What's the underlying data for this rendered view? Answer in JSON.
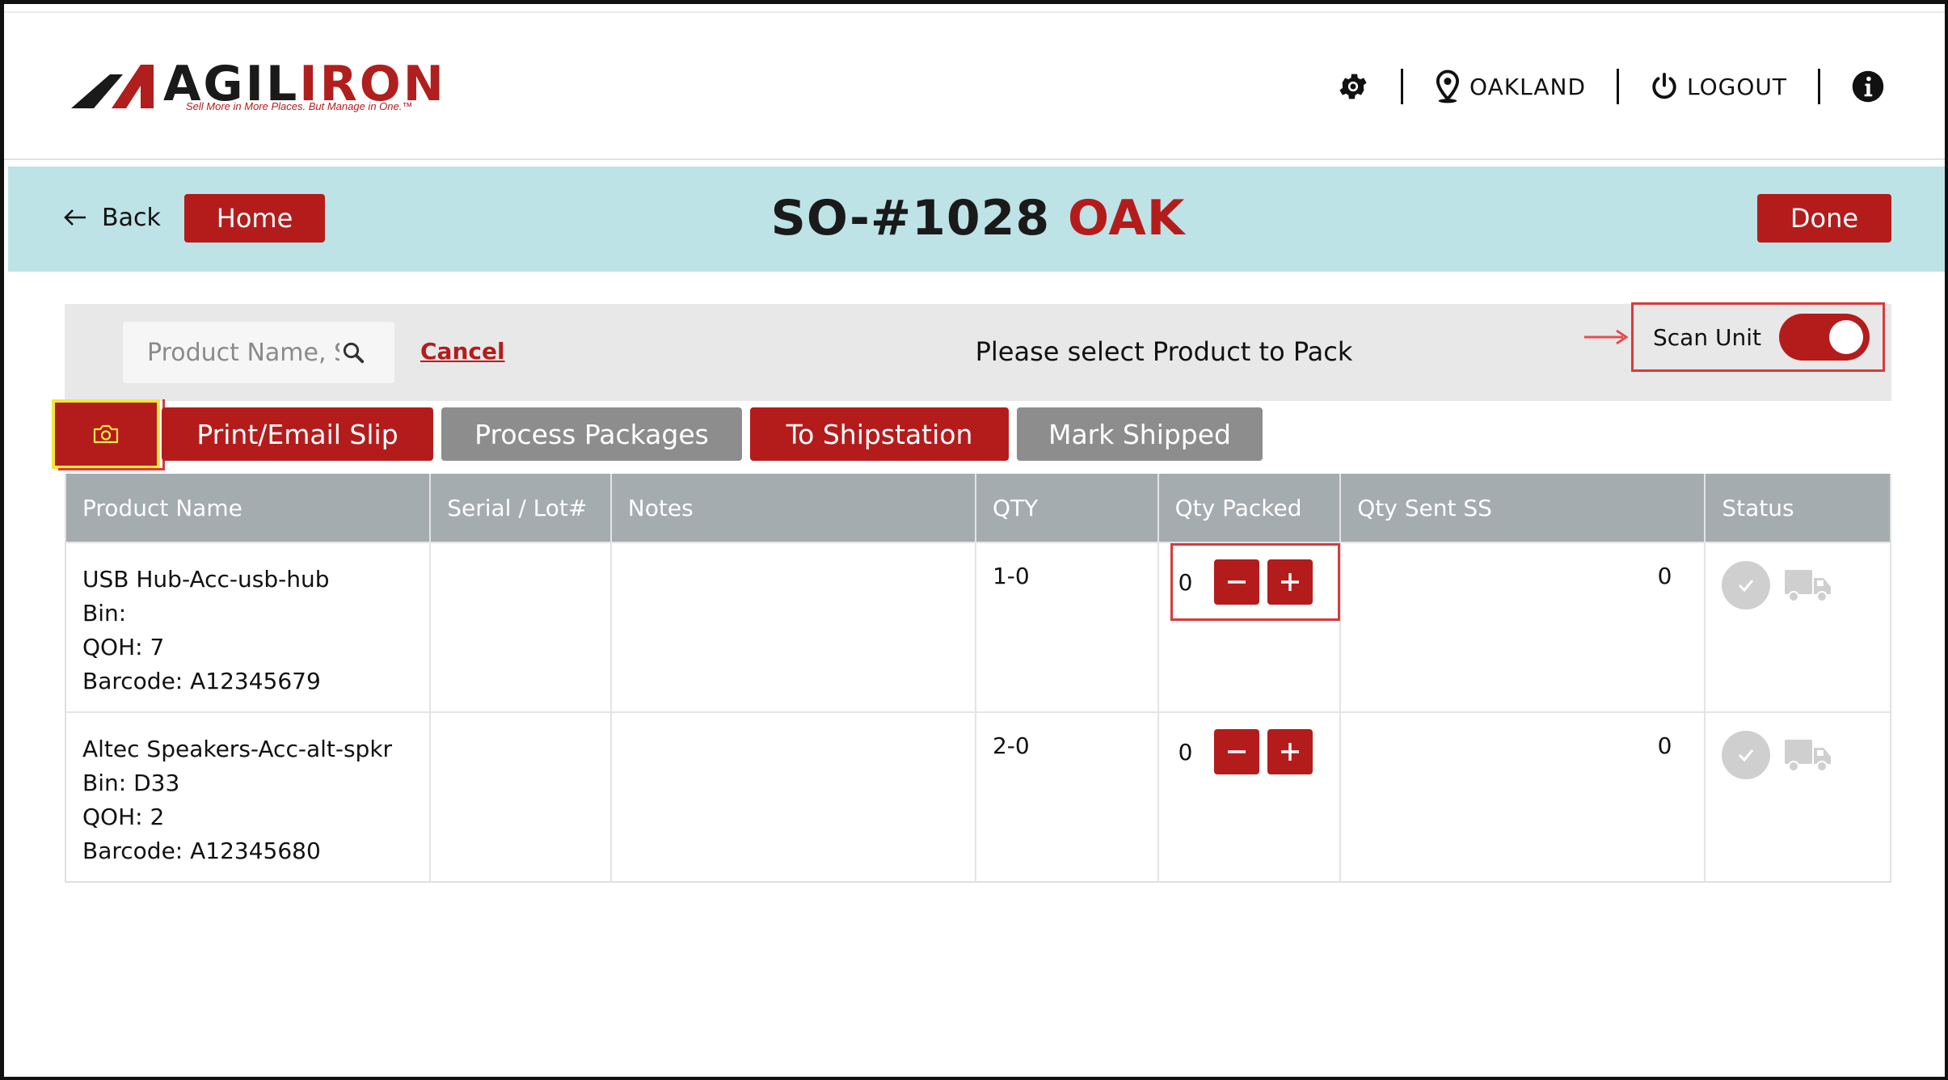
{
  "brand": {
    "name_part1": "AGIL",
    "name_part2": "IRON",
    "tagline": "Sell More in More Places. But Manage in One.™"
  },
  "topnav": {
    "settings_icon": "gear-icon",
    "location_icon": "map-pin-icon",
    "location_label": "OAKLAND",
    "logout_icon": "power-icon",
    "logout_label": "LOGOUT",
    "info_icon": "info-icon"
  },
  "titlebar": {
    "back_label": "Back",
    "home_label": "Home",
    "order_number": "SO-#1028",
    "order_location": "OAK",
    "done_label": "Done"
  },
  "packbar": {
    "search_placeholder": "Product Name, SKU",
    "cancel_label": "Cancel",
    "message": "Please select Product to Pack",
    "scan_label": "Scan Unit",
    "scan_enabled": true
  },
  "actions": {
    "camera_icon": "camera-icon",
    "print_label": "Print/Email Slip",
    "process_label": "Process Packages",
    "shipstation_label": "To Shipstation",
    "mark_shipped_label": "Mark Shipped"
  },
  "table": {
    "columns": [
      "Product Name",
      "Serial / Lot#",
      "Notes",
      "QTY",
      "Qty Packed",
      "Qty Sent SS",
      "Status"
    ],
    "rows": [
      {
        "name": "USB Hub-Acc-usb-hub",
        "bin": "Bin:",
        "qoh": "QOH: 7",
        "barcode": "Barcode: A12345679",
        "serial": "",
        "notes": "",
        "qty": "1-0",
        "qty_packed": "0",
        "qty_sent": "0"
      },
      {
        "name": "Altec Speakers-Acc-alt-spkr",
        "bin": "Bin: D33",
        "qoh": "QOH: 2",
        "barcode": "Barcode: A12345680",
        "serial": "",
        "notes": "",
        "qty": "2-0",
        "qty_packed": "0",
        "qty_sent": "0"
      }
    ]
  },
  "colors": {
    "brand_red": "#b41c1c",
    "teal_bar": "#bde3e6",
    "header_gray": "#a4acaf",
    "highlight_yellow": "#f2e73a"
  }
}
